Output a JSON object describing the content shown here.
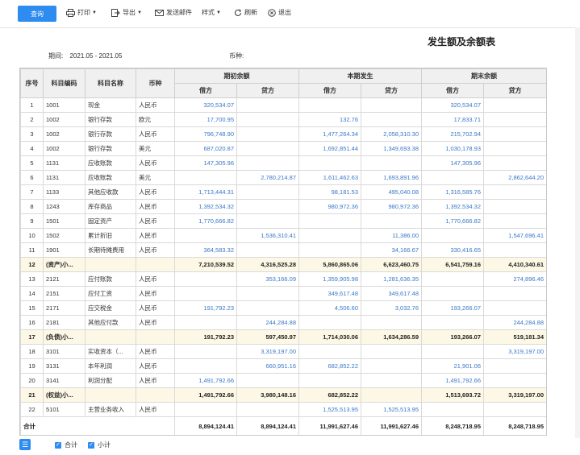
{
  "toolbar": {
    "query": "查询",
    "print": "打印",
    "export": "导出",
    "send_mail": "发送邮件",
    "style": "样式",
    "refresh": "刷新",
    "exit": "退出"
  },
  "report": {
    "title": "发生额及余额表",
    "period_label": "期间:",
    "period_value": "2021.05 - 2021.05",
    "currency_label": "币种:"
  },
  "table": {
    "headers": {
      "seq": "序号",
      "code": "科目编码",
      "name": "科目名称",
      "currency": "币种",
      "opening": "期初余额",
      "current": "本期发生",
      "closing": "期末余额",
      "debit": "借方",
      "credit": "贷方"
    },
    "rows": [
      {
        "seq": "1",
        "code": "1001",
        "name": "现金",
        "cur": "人民币",
        "v": [
          "320,534.07",
          "",
          "",
          "",
          "320,534.07",
          ""
        ],
        "type": "row"
      },
      {
        "seq": "2",
        "code": "1002",
        "name": "银行存款",
        "cur": "欧元",
        "v": [
          "17,700.95",
          "",
          "132.76",
          "",
          "17,833.71",
          ""
        ],
        "type": "row"
      },
      {
        "seq": "3",
        "code": "1002",
        "name": "银行存款",
        "cur": "人民币",
        "v": [
          "796,748.90",
          "",
          "1,477,264.34",
          "2,058,310.30",
          "215,702.94",
          ""
        ],
        "type": "row"
      },
      {
        "seq": "4",
        "code": "1002",
        "name": "银行存款",
        "cur": "美元",
        "v": [
          "687,020.87",
          "",
          "1,692,851.44",
          "1,349,693.38",
          "1,030,178.93",
          ""
        ],
        "type": "row"
      },
      {
        "seq": "5",
        "code": "1131",
        "name": "应收账款",
        "cur": "人民币",
        "v": [
          "147,305.96",
          "",
          "",
          "",
          "147,305.96",
          ""
        ],
        "type": "row"
      },
      {
        "seq": "6",
        "code": "1131",
        "name": "应收账款",
        "cur": "美元",
        "v": [
          "",
          "2,780,214.87",
          "1,611,462.63",
          "1,693,891.96",
          "",
          "2,862,644.20"
        ],
        "type": "row"
      },
      {
        "seq": "7",
        "code": "1133",
        "name": "其他应收款",
        "cur": "人民币",
        "v": [
          "1,713,444.31",
          "",
          "98,181.53",
          "495,040.08",
          "1,316,585.76",
          ""
        ],
        "type": "row"
      },
      {
        "seq": "8",
        "code": "1243",
        "name": "库存商品",
        "cur": "人民币",
        "v": [
          "1,392,534.32",
          "",
          "980,972.36",
          "980,972.36",
          "1,392,534.32",
          ""
        ],
        "type": "row"
      },
      {
        "seq": "9",
        "code": "1501",
        "name": "固定资产",
        "cur": "人民币",
        "v": [
          "1,770,666.82",
          "",
          "",
          "",
          "1,770,666.82",
          ""
        ],
        "type": "row"
      },
      {
        "seq": "10",
        "code": "1502",
        "name": "累计折旧",
        "cur": "人民币",
        "v": [
          "",
          "1,536,310.41",
          "",
          "11,386.00",
          "",
          "1,547,696.41"
        ],
        "type": "row"
      },
      {
        "seq": "11",
        "code": "1901",
        "name": "长期待摊费用",
        "cur": "人民币",
        "v": [
          "364,583.32",
          "",
          "",
          "34,166.67",
          "330,416.65",
          ""
        ],
        "type": "row"
      },
      {
        "seq": "12",
        "code": "(资产)小...",
        "name": "",
        "cur": "",
        "v": [
          "7,210,539.52",
          "4,316,525.28",
          "5,860,865.06",
          "6,623,460.75",
          "6,541,759.16",
          "4,410,340.61"
        ],
        "type": "sub"
      },
      {
        "seq": "13",
        "code": "2121",
        "name": "应付账款",
        "cur": "人民币",
        "v": [
          "",
          "353,166.09",
          "1,359,905.98",
          "1,281,636.35",
          "",
          "274,896.46"
        ],
        "type": "row"
      },
      {
        "seq": "14",
        "code": "2151",
        "name": "应付工资",
        "cur": "人民币",
        "v": [
          "",
          "",
          "349,617.48",
          "349,617.48",
          "",
          ""
        ],
        "type": "row"
      },
      {
        "seq": "15",
        "code": "2171",
        "name": "应交税金",
        "cur": "人民币",
        "v": [
          "191,792.23",
          "",
          "4,506.60",
          "3,032.76",
          "193,266.07",
          ""
        ],
        "type": "row"
      },
      {
        "seq": "16",
        "code": "2181",
        "name": "其他应付款",
        "cur": "人民币",
        "v": [
          "",
          "244,284.88",
          "",
          "",
          "",
          "244,284.88"
        ],
        "type": "row"
      },
      {
        "seq": "17",
        "code": "(负债)小...",
        "name": "",
        "cur": "",
        "v": [
          "191,792.23",
          "597,450.97",
          "1,714,030.06",
          "1,634,286.59",
          "193,266.07",
          "519,181.34"
        ],
        "type": "sub"
      },
      {
        "seq": "18",
        "code": "3101",
        "name": "实收资本（...",
        "cur": "人民币",
        "v": [
          "",
          "3,319,197.00",
          "",
          "",
          "",
          "3,319,197.00"
        ],
        "type": "row"
      },
      {
        "seq": "19",
        "code": "3131",
        "name": "本年利润",
        "cur": "人民币",
        "v": [
          "",
          "660,951.16",
          "682,852.22",
          "",
          "21,901.06",
          ""
        ],
        "type": "row"
      },
      {
        "seq": "20",
        "code": "3141",
        "name": "利润分配",
        "cur": "人民币",
        "v": [
          "1,491,792.66",
          "",
          "",
          "",
          "1,491,792.66",
          ""
        ],
        "type": "row"
      },
      {
        "seq": "21",
        "code": "(权益)小...",
        "name": "",
        "cur": "",
        "v": [
          "1,491,792.66",
          "3,980,148.16",
          "682,852.22",
          "",
          "1,513,693.72",
          "3,319,197.00"
        ],
        "type": "sub"
      },
      {
        "seq": "22",
        "code": "5101",
        "name": "主营业务收入",
        "cur": "人民币",
        "v": [
          "",
          "",
          "1,525,513.95",
          "1,525,513.95",
          "",
          ""
        ],
        "type": "row"
      }
    ],
    "total": {
      "label": "合计",
      "v": [
        "8,894,124.41",
        "8,894,124.41",
        "11,991,627.46",
        "11,991,627.46",
        "8,248,718.95",
        "8,248,718.95"
      ]
    }
  },
  "footer": {
    "total_check": "合计",
    "subtotal_check": "小计"
  }
}
